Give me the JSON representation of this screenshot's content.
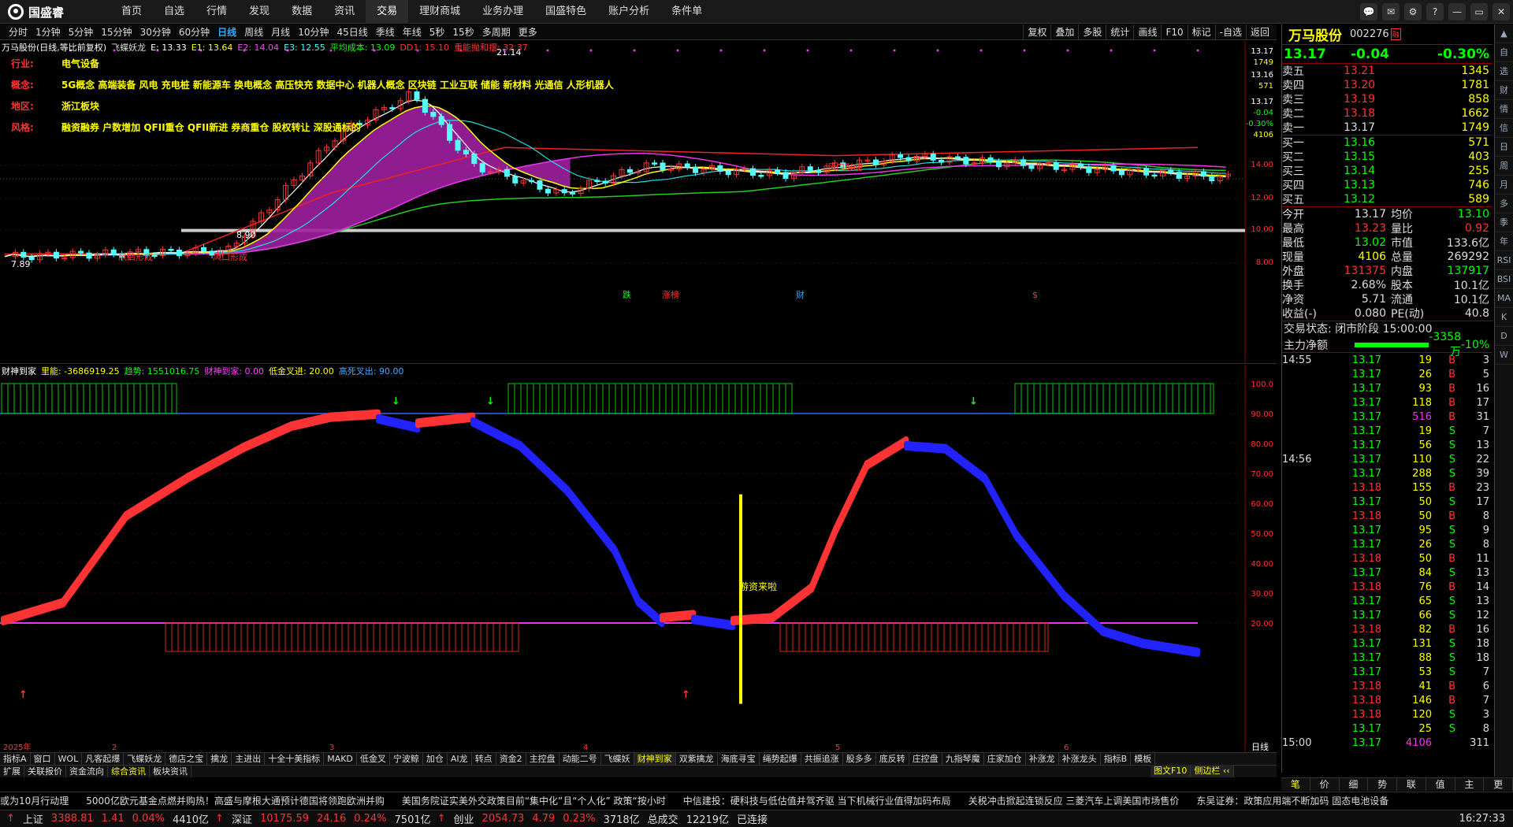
{
  "app": {
    "brand": "国盛睿",
    "nav": [
      "首页",
      "自选",
      "行情",
      "发现",
      "数据",
      "资讯",
      "交易",
      "理财商城",
      "业务办理",
      "国盛特色",
      "账户分析",
      "条件单"
    ],
    "active_nav": "交易",
    "window_buttons": [
      "💬",
      "✉",
      "⚙",
      "?",
      "—",
      "▭",
      "✕"
    ]
  },
  "period_bar": {
    "items": [
      "分时",
      "1分钟",
      "5分钟",
      "15分钟",
      "30分钟",
      "60分钟",
      "日线",
      "周线",
      "月线",
      "10分钟",
      "45日线",
      "季线",
      "年线",
      "5秒",
      "15秒",
      "多周期",
      "更多"
    ],
    "active": "日线",
    "right": [
      "复权",
      "叠加",
      "多股",
      "统计",
      "画线",
      "F10",
      "标记",
      "-自选",
      "返回"
    ]
  },
  "main_chart": {
    "legend": [
      {
        "text": "万马股份(日线,等比前复权)",
        "color": "#ffffff"
      },
      {
        "text": "飞蝶妖龙",
        "color": "#dddddd"
      },
      {
        "text": "E: 13.33",
        "color": "#ffffff"
      },
      {
        "text": "E1: 13.64",
        "color": "#ffff00"
      },
      {
        "text": "E2: 14.04",
        "color": "#ff44ff"
      },
      {
        "text": "E3: 12.55",
        "color": "#44ffff"
      },
      {
        "text": "平均成本: 13.09",
        "color": "#00ff00"
      },
      {
        "text": "DD1: 15.10",
        "color": "#ff3333"
      },
      {
        "text": "重能抛和摆: 32.37",
        "color": "#ff3333"
      }
    ],
    "info": [
      {
        "k": "行业:",
        "v": "电气设备"
      },
      {
        "k": "概念:",
        "v": "5G概念 高端装备 风电 充电桩 新能源车 换电概念 高压快充 数据中心 机器人概念 区块链 工业互联 储能 新材料 光通信 人形机器人"
      },
      {
        "k": "地区:",
        "v": "浙江板块"
      },
      {
        "k": "风格:",
        "v": "融资融券 户数增加 QFII重仓 QFII新进 券商重仓 股权转让 深股通标的"
      }
    ],
    "axis": [
      "13.17",
      "1749",
      "13.16",
      "571",
      "13.17",
      "-0.04",
      "-0.30%",
      "4106",
      "14.00",
      "12.00",
      "10.00",
      "8.00"
    ],
    "annotations": [
      "21.14",
      "风口形成",
      "风口形成",
      "风口形成",
      "7.89",
      "8.90",
      "跌",
      "涨榜",
      "财",
      "$"
    ]
  },
  "ind_chart": {
    "legend": [
      {
        "text": "财神到家",
        "color": "#ffffff"
      },
      {
        "text": "里能: -3686919.25",
        "color": "#ffff00"
      },
      {
        "text": "趋势: 1551016.75",
        "color": "#00ff00"
      },
      {
        "text": "财神到家: 0.00",
        "color": "#ff44ff"
      },
      {
        "text": "低金叉进: 20.00",
        "color": "#ffff00"
      },
      {
        "text": "高死叉出: 90.00",
        "color": "#44aaff"
      }
    ],
    "axis": [
      "100.0",
      "90.00",
      "80.00",
      "70.00",
      "60.00",
      "50.00",
      "40.00",
      "30.00",
      "20.00"
    ],
    "label": "游资来啦",
    "dates": [
      "2025年",
      "2",
      "3",
      "4",
      "5",
      "6"
    ],
    "period_label": "日线"
  },
  "tabs1": [
    "指标A",
    "窗口",
    "WOL",
    "凡客起爆",
    "飞蝶妖龙",
    "德店之宝",
    "擒龙",
    "主进出",
    "十全十美指标",
    "MAKD",
    "低金叉",
    "宁波鲸",
    "加仓",
    "AI龙",
    "转点",
    "资金2",
    "主控盘",
    "动能二号",
    "飞蝶妖",
    "财神到家",
    "双紫擒龙",
    "海底寻宝",
    "绳势起爆",
    "共振追涨",
    "股多多",
    "底反转",
    "庄控盘",
    "九指琴魔",
    "庄家加仓",
    "补涨龙",
    "补涨龙头",
    "指标B",
    "模板"
  ],
  "tabs1_active": "财神到家",
  "tabs2": [
    "扩展",
    "关联报价",
    "资金流向",
    "综合资讯",
    "板块资讯"
  ],
  "tabs2_active": "综合资讯",
  "right_panel": {
    "name": "万马股份",
    "code": "002276",
    "code_tag": "融",
    "price": "13.17",
    "change": "-0.04",
    "pct": "-0.30%",
    "asks": [
      [
        "卖五",
        "13.21",
        "1345"
      ],
      [
        "卖四",
        "13.20",
        "1781"
      ],
      [
        "卖三",
        "13.19",
        "858"
      ],
      [
        "卖二",
        "13.18",
        "1662"
      ],
      [
        "卖一",
        "13.17",
        "1749"
      ]
    ],
    "bids": [
      [
        "买一",
        "13.16",
        "571"
      ],
      [
        "买二",
        "13.15",
        "403"
      ],
      [
        "买三",
        "13.14",
        "255"
      ],
      [
        "买四",
        "13.13",
        "746"
      ],
      [
        "买五",
        "13.12",
        "589"
      ]
    ],
    "quotes": [
      [
        "今开",
        "13.17",
        "均价",
        "13.10"
      ],
      [
        "最高",
        "13.23",
        "量比",
        "0.92"
      ],
      [
        "最低",
        "13.02",
        "市值",
        "133.6亿"
      ],
      [
        "现量",
        "4106",
        "总量",
        "269292"
      ],
      [
        "外盘",
        "131375",
        "内盘",
        "137917"
      ],
      [
        "换手",
        "2.68%",
        "股本",
        "10.1亿"
      ],
      [
        "净资",
        "5.71",
        "流通",
        "10.1亿"
      ],
      [
        "收益(-)",
        "0.080",
        "PE(动)",
        "40.8"
      ]
    ],
    "status": "交易状态: 闭市阶段 15:00:00",
    "mainflow_label": "主力净额",
    "mainflow_value": "-3358万",
    "mainflow_pct": "-10%",
    "ticks": [
      [
        "14:55",
        "13.17",
        "19",
        "B",
        "3"
      ],
      [
        "",
        "13.17",
        "26",
        "B",
        "5"
      ],
      [
        "",
        "13.17",
        "93",
        "B",
        "16"
      ],
      [
        "",
        "13.17",
        "118",
        "B",
        "17"
      ],
      [
        "",
        "13.17",
        "516",
        "B",
        "31"
      ],
      [
        "",
        "13.17",
        "19",
        "S",
        "7"
      ],
      [
        "",
        "13.17",
        "56",
        "S",
        "13"
      ],
      [
        "14:56",
        "13.17",
        "110",
        "S",
        "22"
      ],
      [
        "",
        "13.17",
        "288",
        "S",
        "39"
      ],
      [
        "",
        "13.18",
        "155",
        "B",
        "23"
      ],
      [
        "",
        "13.17",
        "50",
        "S",
        "17"
      ],
      [
        "",
        "13.18",
        "50",
        "B",
        "8"
      ],
      [
        "",
        "13.17",
        "95",
        "S",
        "9"
      ],
      [
        "",
        "13.17",
        "26",
        "S",
        "8"
      ],
      [
        "",
        "13.18",
        "50",
        "B",
        "11"
      ],
      [
        "",
        "13.17",
        "84",
        "S",
        "13"
      ],
      [
        "",
        "13.18",
        "76",
        "B",
        "14"
      ],
      [
        "",
        "13.17",
        "65",
        "S",
        "13"
      ],
      [
        "",
        "13.17",
        "66",
        "S",
        "12"
      ],
      [
        "",
        "13.18",
        "82",
        "B",
        "16"
      ],
      [
        "",
        "13.17",
        "131",
        "S",
        "18"
      ],
      [
        "",
        "13.17",
        "88",
        "S",
        "18"
      ],
      [
        "",
        "13.17",
        "53",
        "S",
        "7"
      ],
      [
        "",
        "13.18",
        "41",
        "B",
        "6"
      ],
      [
        "",
        "13.18",
        "146",
        "B",
        "7"
      ],
      [
        "",
        "13.18",
        "120",
        "S",
        "3"
      ],
      [
        "",
        "13.17",
        "25",
        "S",
        "8"
      ],
      [
        "15:00",
        "13.17",
        "4106",
        "",
        "311"
      ]
    ],
    "tabs": [
      "笔",
      "价",
      "细",
      "势",
      "联",
      "值",
      "主",
      "更"
    ],
    "tabs_active": "笔",
    "sub_tabs": [
      "图文F10",
      "侧边栏 ‹‹"
    ]
  },
  "sidebar": [
    "▲",
    "自",
    "选",
    "财",
    "情",
    "信",
    "日",
    "周",
    "月",
    "多",
    "季",
    "年",
    "RSI",
    "BSI",
    "MA",
    "K",
    "D",
    "W"
  ],
  "news": [
    "或为10月行动理",
    "5000亿欧元基金点燃并购热！高盛与摩根大通预计德国将领跑欧洲并购",
    "美国务院证实美外交政策目前“集中化”且“个人化” 政策“按小时",
    "中信建投：硬科技与低估值并驾齐驱 当下机械行业值得加码布局",
    "关税冲击掀起连锁反应 三菱汽车上调美国市场售价",
    "东吴证券：政策应用端不断加码 固态电池设备"
  ],
  "status": {
    "items": [
      [
        "上证",
        "3388.81",
        "1.41",
        "0.04%",
        "4410亿"
      ],
      [
        "深证",
        "10175.59",
        "24.16",
        "0.24%",
        "7501亿"
      ],
      [
        "创业",
        "2054.73",
        "4.79",
        "0.23%",
        "3718亿"
      ]
    ],
    "total_label": "总成交",
    "total": "12219亿",
    "conn": "已连接",
    "time": "16:27:33"
  }
}
